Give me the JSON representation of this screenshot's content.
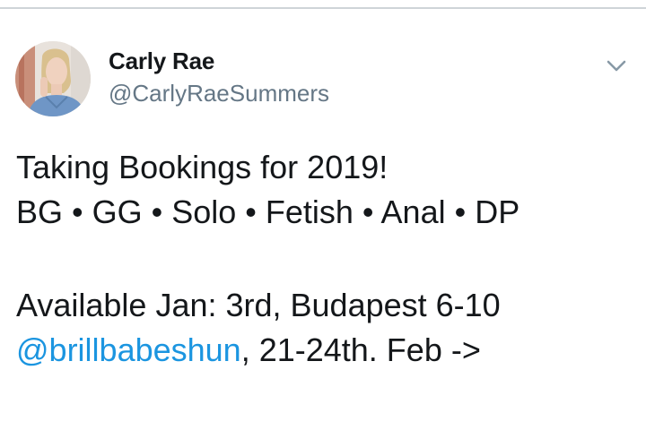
{
  "tweet": {
    "author": {
      "display_name": "Carly Rae",
      "handle": "@CarlyRaeSummers",
      "avatar_icon": "profile-photo"
    },
    "menu_icon": "chevron-down-icon",
    "body": {
      "line1": "Taking Bookings for 2019!",
      "line2": "BG • GG • Solo • Fetish • Anal • DP",
      "line3": "Available Jan: 3rd, Budapest 6-10",
      "mention": "@brillbabeshun",
      "line4_rest": ", 21-24th. Feb ->"
    }
  },
  "colors": {
    "text": "#14171a",
    "handle": "#657786",
    "link": "#1b95e0",
    "chevron": "#8899a6",
    "divider": "#cfd4d8"
  }
}
